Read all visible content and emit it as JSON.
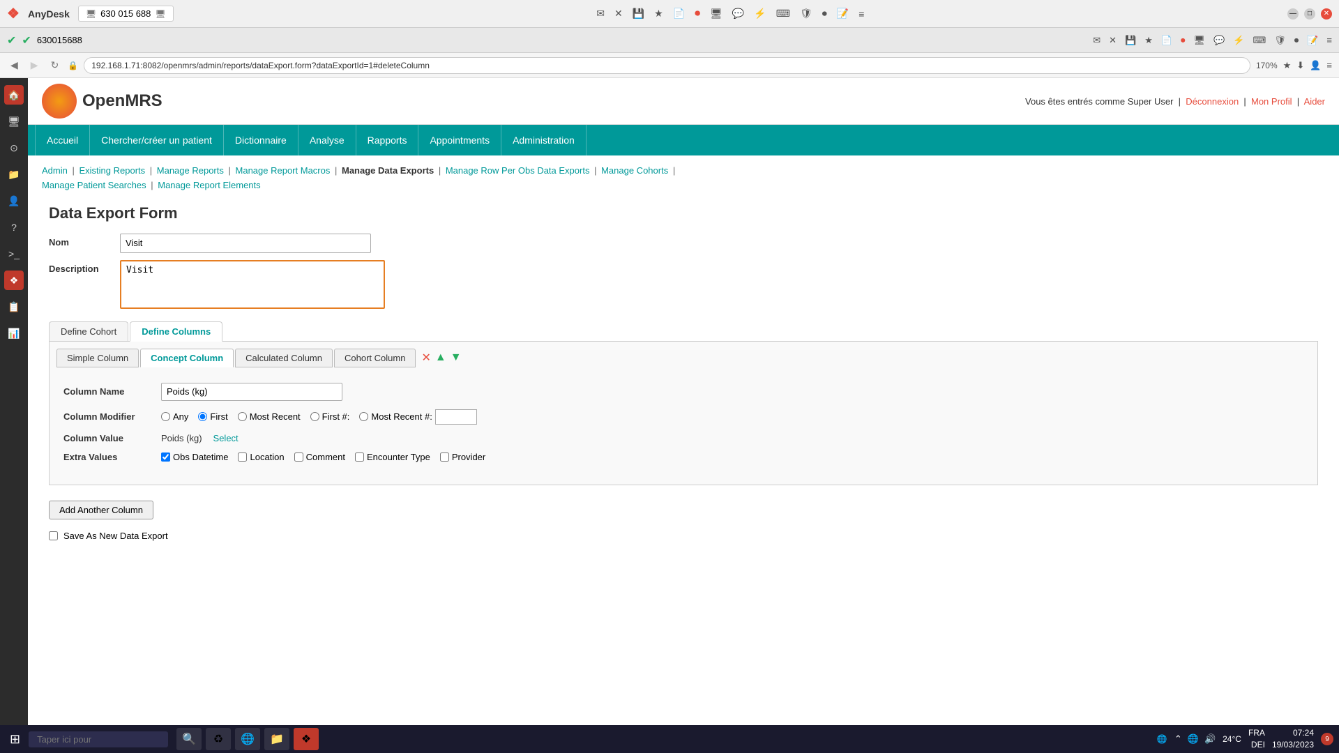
{
  "titlebar": {
    "app_name": "AnyDesk",
    "connection_id": "630 015 688",
    "controls": {
      "minimize": "—",
      "maximize": "□",
      "close": "✕"
    }
  },
  "taskbar2": {
    "status_id": "630015688",
    "icons": [
      "✉",
      "✕",
      "💾",
      "★",
      "📄",
      "🔴",
      "🖥",
      "💬",
      "⚡",
      "⌨",
      "🛡",
      "⏺",
      "📝",
      "≡"
    ]
  },
  "browser": {
    "url": "192.168.1.71:8082/openmrs/admin/reports/dataExport.form?dataExportId=1#deleteColumn",
    "zoom": "170%"
  },
  "openmrs": {
    "logo_text": "OpenMRS",
    "header_right": "Vous êtes entrés comme Super User",
    "deconnexion": "Déconnexion",
    "mon_profil": "Mon Profil",
    "aider": "Aider"
  },
  "nav": {
    "items": [
      "Accueil",
      "Chercher/créer un patient",
      "Dictionnaire",
      "Analyse",
      "Rapports",
      "Appointments",
      "Administration"
    ]
  },
  "breadcrumb": {
    "items": [
      {
        "label": "Admin",
        "href": "#"
      },
      {
        "label": "Existing Reports",
        "href": "#"
      },
      {
        "label": "Manage Reports",
        "href": "#"
      },
      {
        "label": "Manage Report Macros",
        "href": "#"
      },
      {
        "label": "Manage Data Exports",
        "href": "#",
        "current": true
      },
      {
        "label": "Manage Row Per Obs Data Exports",
        "href": "#"
      },
      {
        "label": "Manage Cohorts",
        "href": "#"
      },
      {
        "label": "Manage Patient Searches",
        "href": "#"
      },
      {
        "label": "Manage Report Elements",
        "href": "#"
      }
    ]
  },
  "page": {
    "title": "Data Export Form",
    "nom_label": "Nom",
    "nom_value": "Visit",
    "description_label": "Description",
    "description_value": "Visit"
  },
  "tabs": {
    "define_cohort": "Define Cohort",
    "define_columns": "Define Columns"
  },
  "inner_tabs": {
    "simple_column": "Simple Column",
    "concept_column": "Concept Column",
    "calculated_column": "Calculated Column",
    "cohort_column": "Cohort Column"
  },
  "column_form": {
    "column_name_label": "Column Name",
    "column_name_value": "Poids (kg)",
    "column_modifier_label": "Column Modifier",
    "modifiers": [
      {
        "label": "Any",
        "value": "any",
        "checked": false
      },
      {
        "label": "First",
        "value": "first",
        "checked": true
      },
      {
        "label": "Most Recent",
        "value": "most_recent",
        "checked": false
      },
      {
        "label": "First #:",
        "value": "first_num",
        "checked": false
      },
      {
        "label": "Most Recent #:",
        "value": "most_recent_num",
        "checked": false
      }
    ],
    "column_value_label": "Column Value",
    "column_value_text": "Poids (kg)",
    "select_link": "Select",
    "extra_values_label": "Extra Values",
    "extra_values": [
      {
        "label": "Obs Datetime",
        "checked": true
      },
      {
        "label": "Location",
        "checked": false
      },
      {
        "label": "Comment",
        "checked": false
      },
      {
        "label": "Encounter Type",
        "checked": false
      },
      {
        "label": "Provider",
        "checked": false
      }
    ],
    "add_another_label": "Add Another Column",
    "save_label": "Save As New Data Export"
  },
  "windows_taskbar": {
    "search_placeholder": "Taper ici pour",
    "apps": [
      "⊞",
      "🔍",
      "🌐",
      "📁",
      "⚙",
      "🔴"
    ],
    "temp": "24°C",
    "lang": "FRA",
    "kb": "DEI",
    "time": "07:24",
    "date": "19/03/2023",
    "notification_count": "9"
  }
}
